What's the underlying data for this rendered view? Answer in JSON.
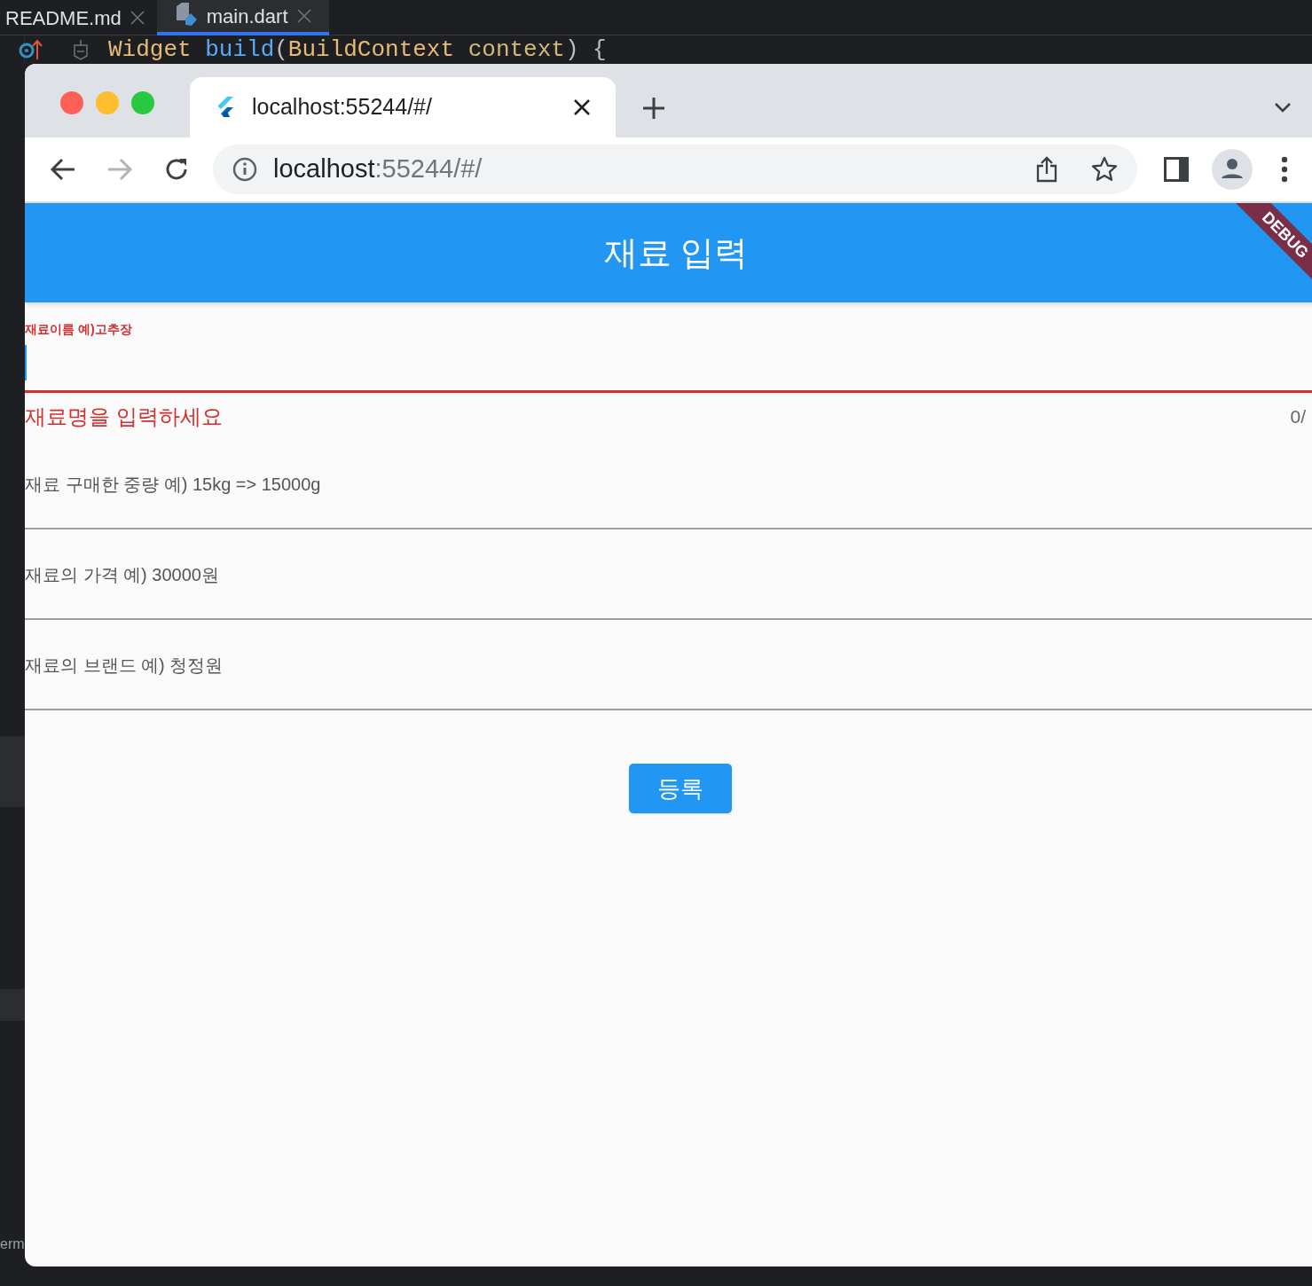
{
  "editor": {
    "tabs": [
      {
        "label": "README.md",
        "selected": false
      },
      {
        "label": "main.dart",
        "selected": true
      }
    ],
    "code_line": [
      {
        "text": "Widget ",
        "kind": "type"
      },
      {
        "text": "build",
        "kind": "func"
      },
      {
        "text": "(",
        "kind": "punct"
      },
      {
        "text": "BuildContext ",
        "kind": "type"
      },
      {
        "text": "context",
        "kind": "param"
      },
      {
        "text": ") {",
        "kind": "punct"
      }
    ],
    "bottom_label": "erm"
  },
  "browser": {
    "tab": {
      "title": "localhost:55244/#/"
    },
    "address": {
      "host": "localhost",
      "rest": ":55244/#/"
    }
  },
  "app": {
    "title": "재료 입력",
    "debug_banner": "DEBUG",
    "fields": [
      {
        "label": "재료이름 예)고추장",
        "focused": true,
        "error": "재료명을 입력하세요",
        "counter": "0/"
      },
      {
        "placeholder": "재료 구매한 중량 예) 15kg => 15000g",
        "focused": false
      },
      {
        "placeholder": "재료의 가격 예) 30000원",
        "focused": false
      },
      {
        "placeholder": "재료의 브랜드 예) 청정원",
        "focused": false
      }
    ],
    "submit_button": "등록"
  }
}
